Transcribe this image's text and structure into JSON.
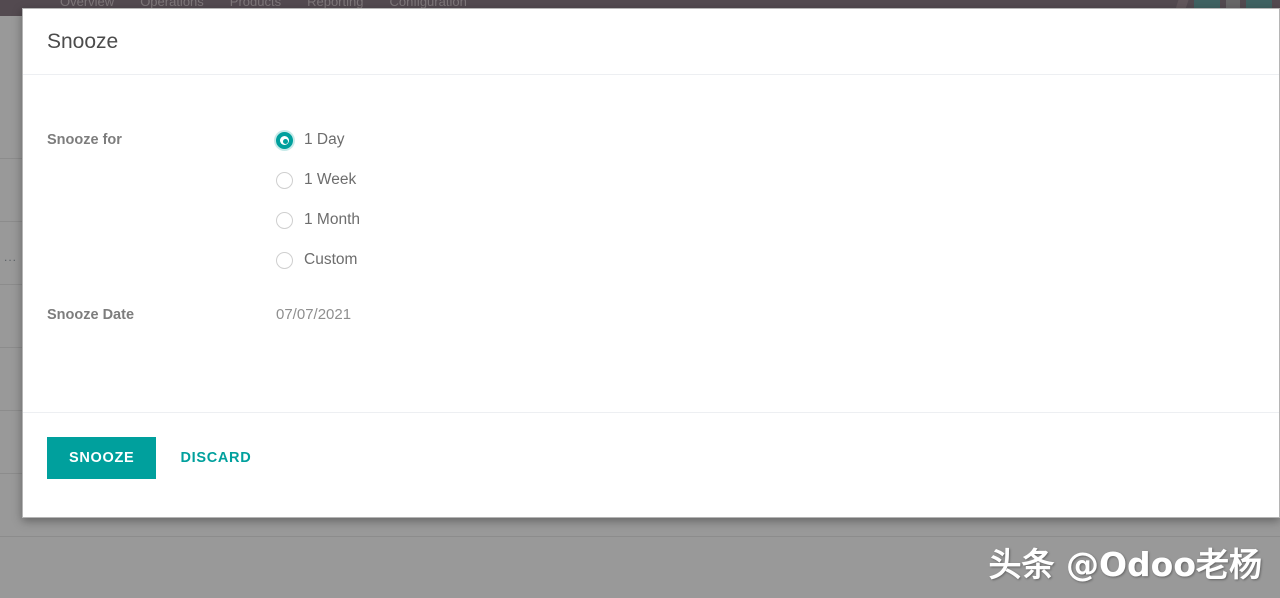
{
  "app": {
    "navbar": {
      "menu_items": [
        {
          "label": "Overview"
        },
        {
          "label": "Operations"
        },
        {
          "label": "Products"
        },
        {
          "label": "Reporting"
        },
        {
          "label": "Configuration"
        }
      ]
    },
    "list": {
      "row_overflow_label": "..."
    }
  },
  "dialog": {
    "title": "Snooze",
    "fields": {
      "snooze_for_label": "Snooze for",
      "snooze_date_label": "Snooze Date",
      "snooze_date_value": "07/07/2021"
    },
    "snooze_for_options": [
      {
        "label": "1 Day",
        "selected": true
      },
      {
        "label": "1 Week",
        "selected": false
      },
      {
        "label": "1 Month",
        "selected": false
      },
      {
        "label": "Custom",
        "selected": false
      }
    ],
    "footer": {
      "confirm_label": "SNOOZE",
      "discard_label": "DISCARD"
    }
  },
  "watermark": {
    "text": "头条 @Odoo老杨"
  },
  "colors": {
    "accent": "#00A09D",
    "navbar": "#47303F",
    "backdrop": "#808080"
  }
}
